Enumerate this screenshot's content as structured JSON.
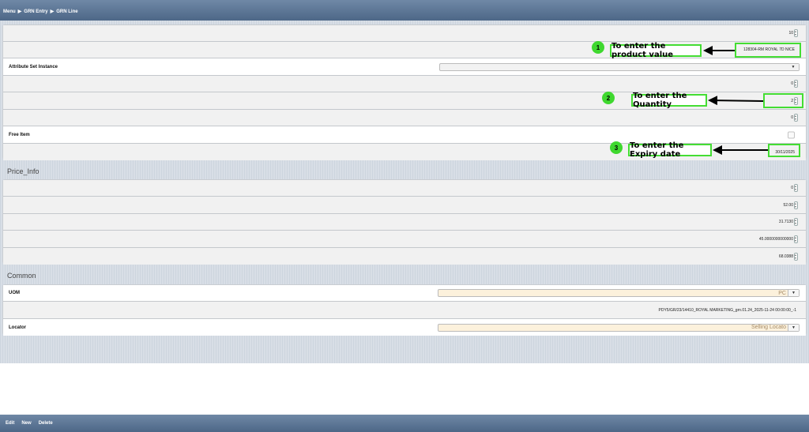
{
  "breadcrumb": [
    "Menu",
    "GRN Entry",
    "GRN Line"
  ],
  "crumb_sep": "▶",
  "main": {
    "rows": {
      "line_no": "10",
      "product": "128304-RM ROYAL 7D NICE",
      "attribute_set_label": "Attribute Set Instance",
      "attribute_set_value": "",
      "val_zero_1": "0",
      "quantity": "2",
      "val_zero_2": "0",
      "free_item_label": "Free Item",
      "expiry": "30/11/2025"
    },
    "price_info": {
      "title": "Price_Info",
      "values": [
        "0",
        "52.00",
        "31.7130",
        "45.0000000000000",
        "68.0388"
      ]
    },
    "common": {
      "title": "Common",
      "uom_label": "UOM",
      "uom_value": "PC",
      "path": "PDY5/GR/23/14410_ROYAL MARKETING_grn.01.24_2025-11-24 00:00:00_-1",
      "locator_label": "Locator",
      "locator_value": "Selling Locato"
    }
  },
  "annotations": [
    {
      "number": "1",
      "text": "To enter the product value"
    },
    {
      "number": "2",
      "text": "To enter the Quantity"
    },
    {
      "number": "3",
      "text": "To enter the Expiry date"
    }
  ],
  "bottom_actions": [
    "Edit",
    "New",
    "Delete"
  ],
  "colors": {
    "accent": "#44dd33",
    "header": "#5d7796",
    "field_tan": "#fcf1dc"
  }
}
